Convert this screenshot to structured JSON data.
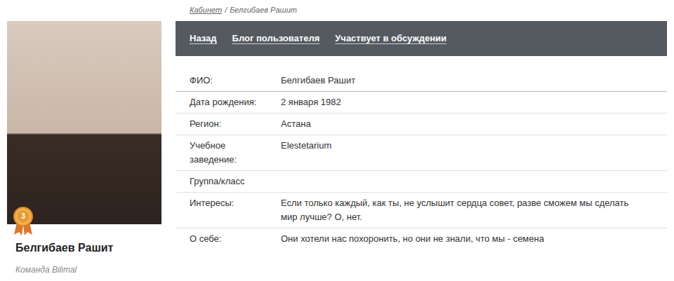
{
  "breadcrumb": {
    "items": [
      {
        "label": "Кабинет",
        "link": true
      },
      {
        "label": "Белгибаев Рашит",
        "link": false
      }
    ],
    "separator": "/"
  },
  "profile": {
    "name": "Белгибаев Рашит",
    "team": "Команда Bilimal",
    "badge": "3"
  },
  "nav": [
    {
      "label": "Назад"
    },
    {
      "label": "Блог пользователя"
    },
    {
      "label": "Участвует в обсуждении"
    }
  ],
  "fields": [
    {
      "label": "ФИО:",
      "value": "Белгибаев Рашит"
    },
    {
      "label": "Дата рождения:",
      "value": "2 января 1982"
    },
    {
      "label": "Регион:",
      "value": "Астана"
    },
    {
      "label": "Учебное заведение:",
      "value": "Elestetarium"
    },
    {
      "label": "Группа/класс",
      "value": ""
    },
    {
      "label": "Интересы:",
      "value": "Если только каждый, как ты, не услышит сердца совет, разве сможем мы сделать мир лучше? О, нет."
    },
    {
      "label": "О себе:",
      "value": "Они хотели нас похоронить, но они не знали, что мы - семена"
    }
  ]
}
